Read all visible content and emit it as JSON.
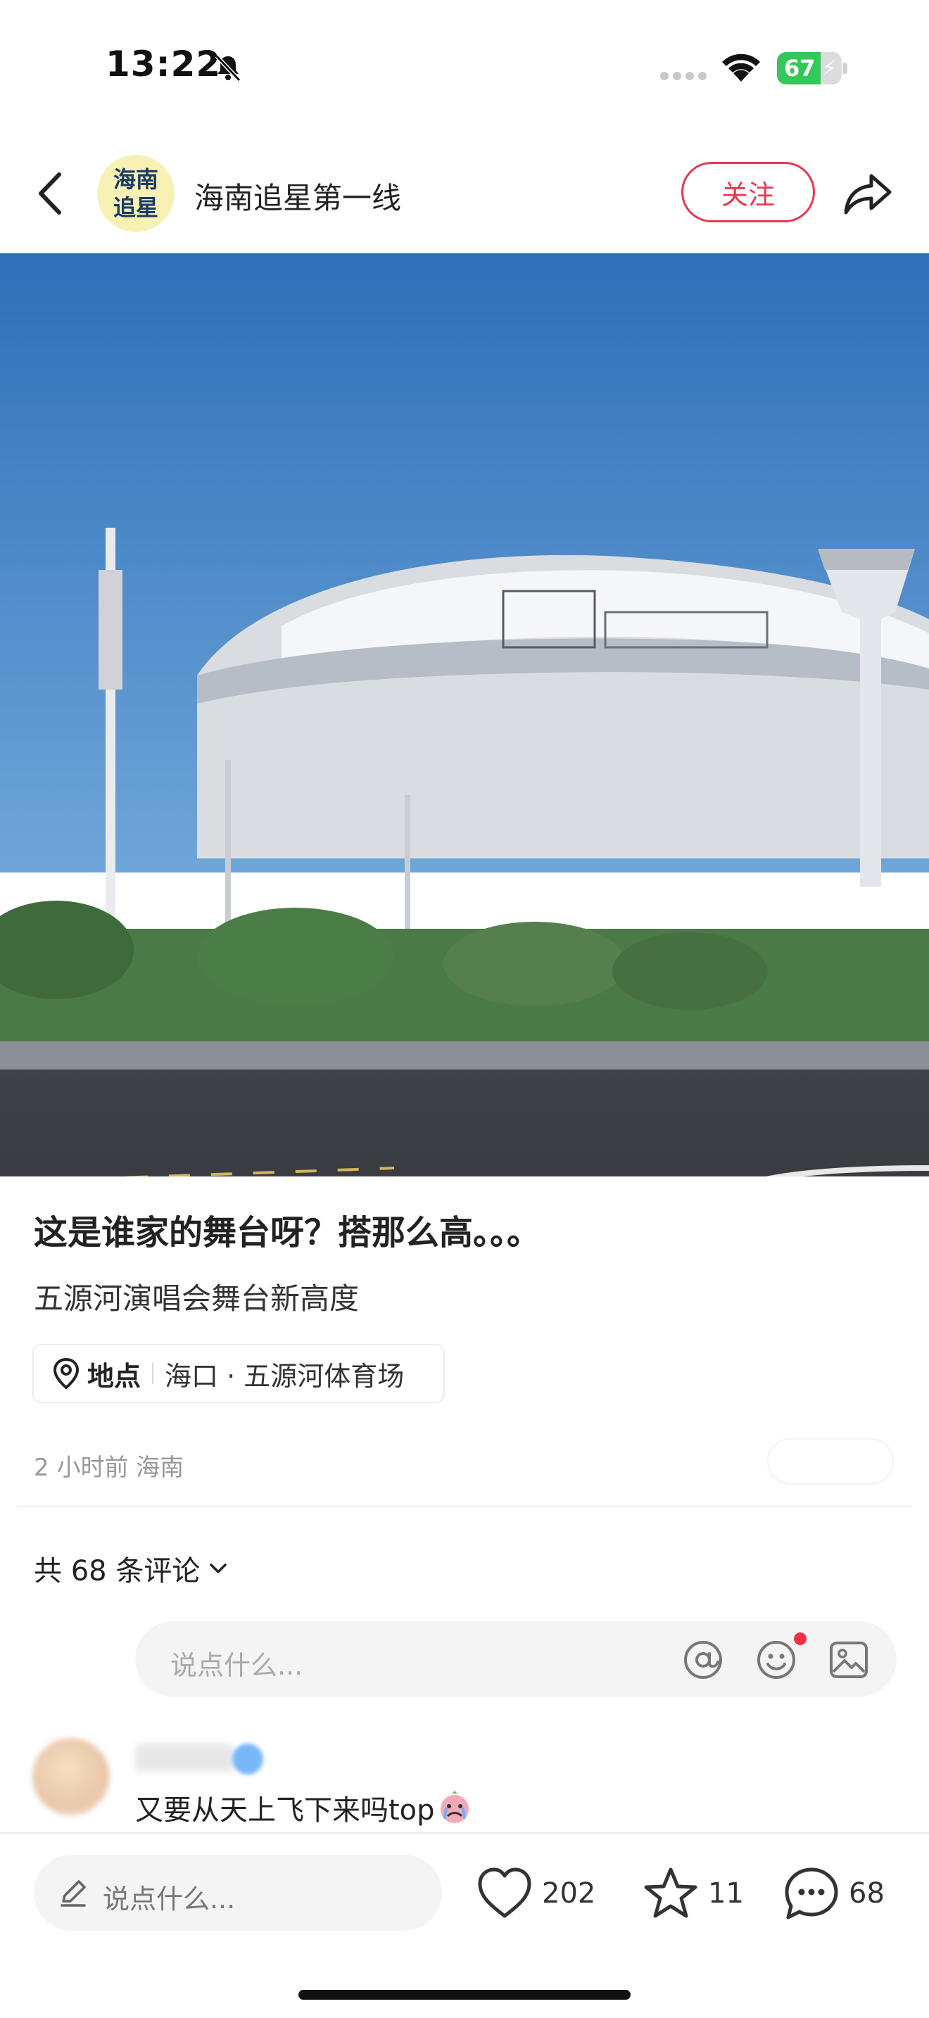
{
  "status_bar": {
    "time": "13:22",
    "battery_level": "67",
    "battery_percent": 67
  },
  "header": {
    "avatar_line1": "海南",
    "avatar_line2": "追星",
    "account_name": "海南追星第一线",
    "follow_label": "关注",
    "icons": [
      "back-icon",
      "share-icon"
    ]
  },
  "post": {
    "title": "这是谁家的舞台呀？搭那么高。。。",
    "description": "五源河演唱会舞台新高度",
    "location_label": "地点",
    "location_value": "海口 · 五源河体育场",
    "meta": "2 小时前 海南"
  },
  "comments": {
    "count_label": "共 68 条评论",
    "input_placeholder": "说点什么...",
    "items": [
      {
        "text": "又要从天上飞下来吗top"
      }
    ]
  },
  "bottom_bar": {
    "input_placeholder": "说点什么...",
    "likes": "202",
    "collects": "11",
    "comments": "68"
  },
  "colors": {
    "accent": "#e8384f",
    "battery": "#34c759",
    "sky": "#3a7fc4"
  }
}
